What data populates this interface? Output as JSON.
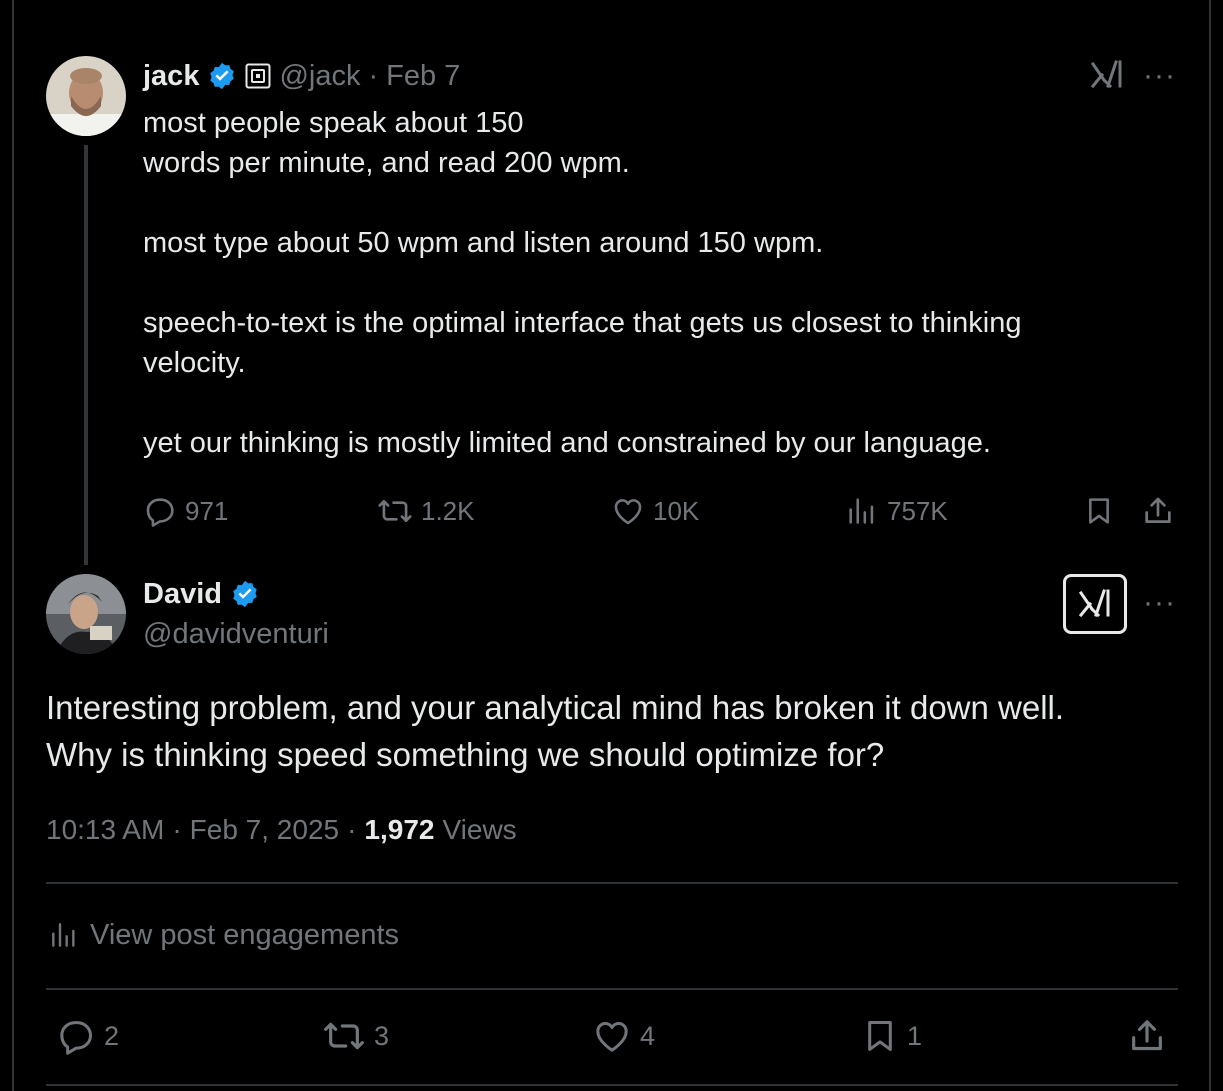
{
  "original_tweet": {
    "author_name": "jack",
    "handle": "@jack",
    "date": "Feb 7",
    "body": "most people speak about 150\nwords per minute, and read 200 wpm.\n\nmost type about 50 wpm and listen around 150 wpm.\n\nspeech-to-text is the optimal interface that gets us closest to thinking\nvelocity.\n\nyet our thinking is mostly limited and constrained by our language.",
    "replies": "971",
    "reposts": "1.2K",
    "likes": "10K",
    "views": "757K"
  },
  "reply_tweet": {
    "author_name": "David",
    "handle": "@davidventuri",
    "body": "Interesting problem, and your analytical mind has broken it down well.\nWhy is thinking speed something we should optimize for?",
    "time": "10:13 AM",
    "date": "Feb 7, 2025",
    "views_count": "1,972",
    "views_label": "Views",
    "engagements_label": "View post engagements",
    "replies": "2",
    "reposts": "3",
    "likes": "4",
    "bookmarks": "1"
  },
  "separator": "·",
  "more_label": "···",
  "icons": {
    "verified": "verified-badge-icon",
    "square": "square-affiliation-icon",
    "grok": "grok-icon",
    "reply": "reply-icon",
    "repost": "repost-icon",
    "like": "heart-icon",
    "views": "views-chart-icon",
    "bookmark": "bookmark-icon",
    "share": "share-icon"
  },
  "colors": {
    "background": "#000000",
    "text": "#e7e9ea",
    "muted": "#71767b",
    "verified": "#1d9bf0",
    "divider": "#2f3336"
  }
}
